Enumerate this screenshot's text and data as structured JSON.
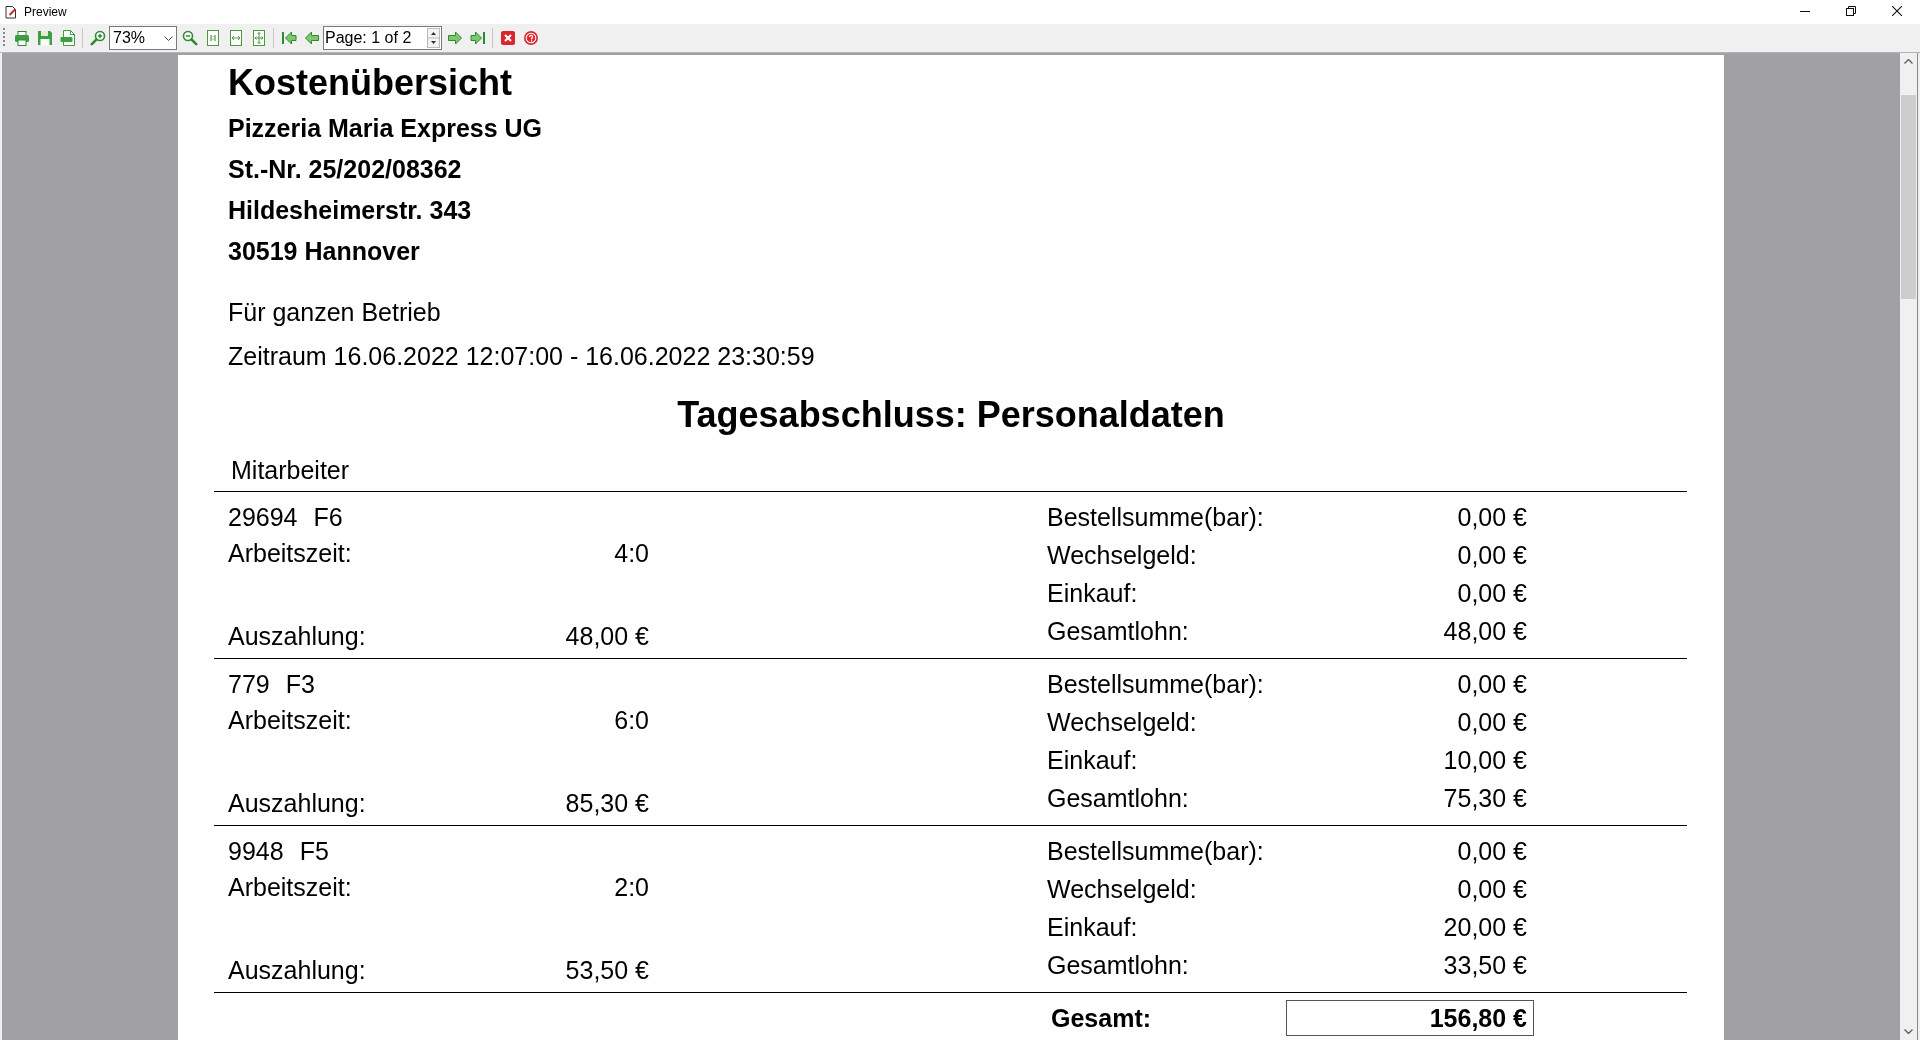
{
  "window": {
    "title": "Preview"
  },
  "toolbar": {
    "zoom": "73%",
    "page": "Page: 1 of 2"
  },
  "report": {
    "title": "Kostenübersicht",
    "company": [
      "Pizzeria Maria Express UG",
      "St.-Nr. 25/202/08362",
      "Hildesheimerstr. 343",
      "30519 Hannover"
    ],
    "scope": "Für ganzen Betrieb",
    "period": "Zeitraum 16.06.2022 12:07:00 - 16.06.2022 23:30:59",
    "section_title": "Tagesabschluss: Personaldaten",
    "column_header": "Mitarbeiter",
    "employees": [
      {
        "number": "29694",
        "code": "F6",
        "work_time": {
          "label": "Arbeitszeit:",
          "value": "4:0"
        },
        "payout": {
          "label": "Auszahlung:",
          "value": "48,00 €"
        },
        "figures": [
          {
            "label": "Bestellsumme(bar):",
            "value": "0,00 €"
          },
          {
            "label": "Wechselgeld:",
            "value": "0,00 €"
          },
          {
            "label": "Einkauf:",
            "value": "0,00 €"
          },
          {
            "label": "Gesamtlohn:",
            "value": "48,00 €"
          }
        ]
      },
      {
        "number": "779",
        "code": "F3",
        "work_time": {
          "label": "Arbeitszeit:",
          "value": "6:0"
        },
        "payout": {
          "label": "Auszahlung:",
          "value": "85,30 €"
        },
        "figures": [
          {
            "label": "Bestellsumme(bar):",
            "value": "0,00 €"
          },
          {
            "label": "Wechselgeld:",
            "value": "0,00 €"
          },
          {
            "label": "Einkauf:",
            "value": "10,00 €"
          },
          {
            "label": "Gesamtlohn:",
            "value": "75,30 €"
          }
        ]
      },
      {
        "number": "9948",
        "code": "F5",
        "work_time": {
          "label": "Arbeitszeit:",
          "value": "2:0"
        },
        "payout": {
          "label": "Auszahlung:",
          "value": "53,50 €"
        },
        "figures": [
          {
            "label": "Bestellsumme(bar):",
            "value": "0,00 €"
          },
          {
            "label": "Wechselgeld:",
            "value": "0,00 €"
          },
          {
            "label": "Einkauf:",
            "value": "20,00 €"
          },
          {
            "label": "Gesamtlohn:",
            "value": "33,50 €"
          }
        ]
      }
    ],
    "total": {
      "label": "Gesamt:",
      "value": "156,80 €"
    }
  }
}
